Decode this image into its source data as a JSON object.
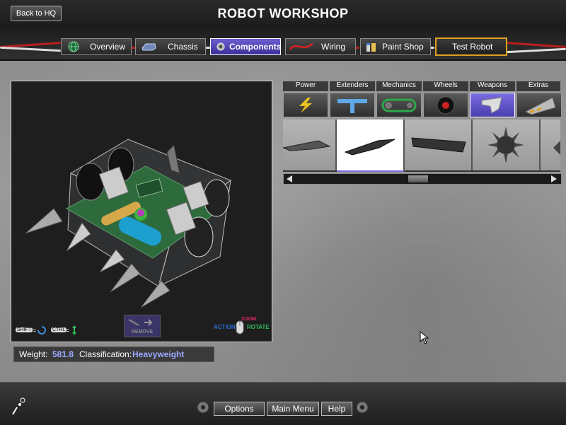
{
  "header": {
    "title": "ROBOT WORKSHOP",
    "back_label": "Back to HQ"
  },
  "nav": {
    "tabs": [
      {
        "label": "Overview",
        "icon": "globe-icon"
      },
      {
        "label": "Chassis",
        "icon": "chassis-icon"
      },
      {
        "label": "Components",
        "icon": "gear-icon",
        "active": true
      },
      {
        "label": "Wiring",
        "icon": "wire-icon"
      },
      {
        "label": "Paint Shop",
        "icon": "paint-icon"
      },
      {
        "label": "Test Robot",
        "icon": "hazard-icon"
      }
    ]
  },
  "viewport": {
    "shift_key": "SHIFT",
    "ctrl_key": "CTRL",
    "remove_label": "REMOVE",
    "action_label": "ACTION",
    "zoom_label": "ZOOM",
    "rotate_label": "ROTATE"
  },
  "stats": {
    "weight_label": "Weight:",
    "weight_value": "581.8",
    "class_label": "Classification:",
    "class_value": "Heavyweight"
  },
  "parts": {
    "categories": [
      {
        "label": "Power",
        "icon": "lightning-icon"
      },
      {
        "label": "Extenders",
        "icon": "extender-icon"
      },
      {
        "label": "Mechanics",
        "icon": "chain-icon"
      },
      {
        "label": "Wheels",
        "icon": "wheel-icon"
      },
      {
        "label": "Weapons",
        "icon": "blade-icon",
        "active": true
      },
      {
        "label": "Extras",
        "icon": "wedge-icon"
      }
    ],
    "items": [
      "claw-blade",
      "spike-blade",
      "flat-blade",
      "spiked-ball",
      "partial-item"
    ],
    "selected_index": 1
  },
  "footer": {
    "options_label": "Options",
    "main_menu_label": "Main Menu",
    "help_label": "Help"
  },
  "colors": {
    "accent": "#6d5fd0",
    "stat_value": "#9aa8ff",
    "test_border": "#e0a020"
  }
}
